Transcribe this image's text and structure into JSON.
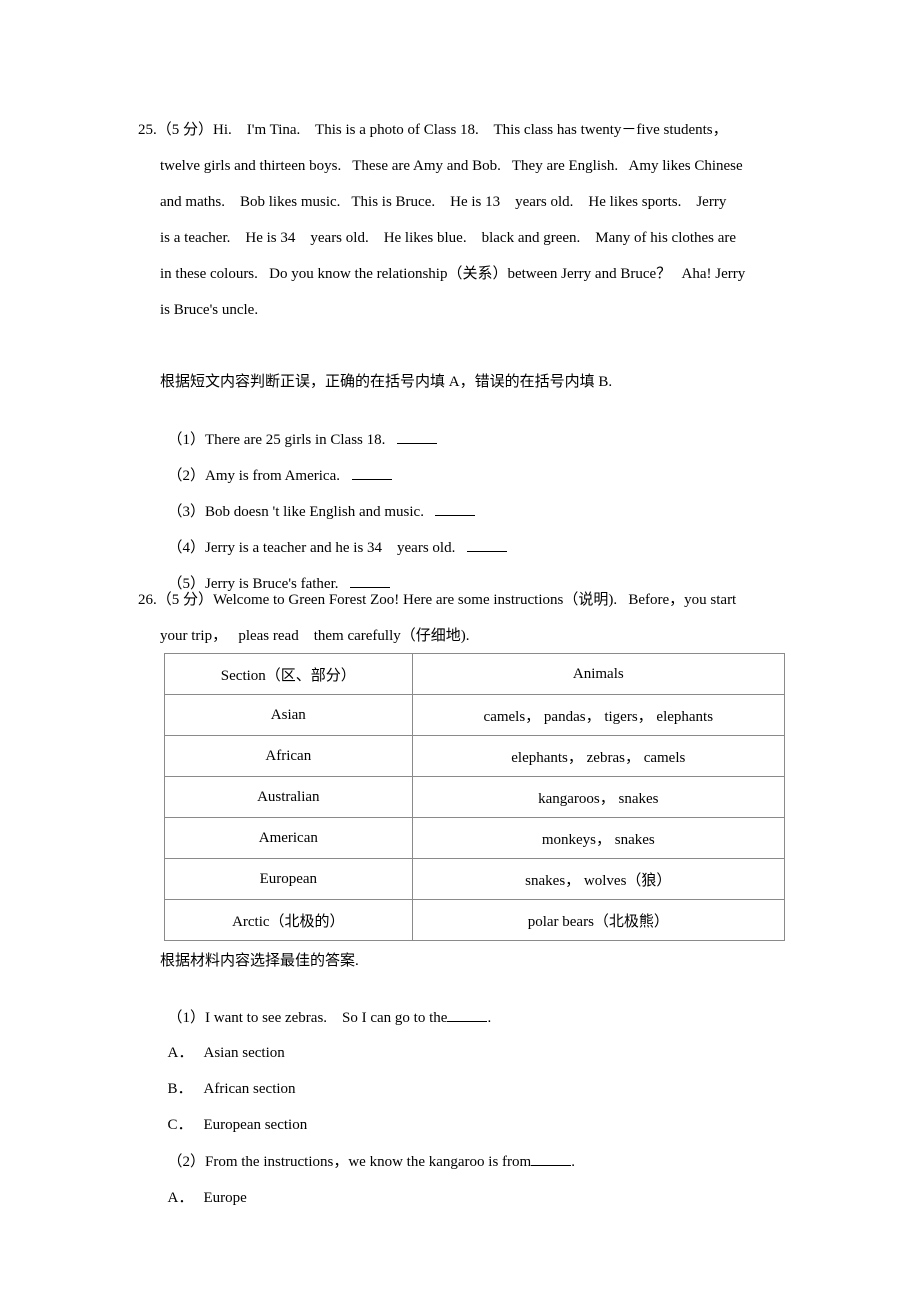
{
  "q25": {
    "lines": [
      "25.（5 分）Hi.    I'm Tina.    This is a photo of Class 18.    This class has twenty－five students，",
      "twelve girls and thirteen boys.   These are Amy and Bob.   They are English.   Amy likes Chinese",
      "and maths.    Bob likes music.   This is Bruce.    He is 13    years old.    He likes sports.    Jerry",
      "is a teacher.    He is 34    years old.    He likes blue.    black and green.    Many of his clothes are",
      "in these colours.   Do you know the relationship（关系）between Jerry and Bruce？   Aha! Jerry",
      "is Bruce's uncle."
    ],
    "instruction": "根据短文内容判断正误，正确的在括号内填 A，错误的在括号内填 B.",
    "questions": [
      {
        "num": "（1）",
        "text": "There are 25 girls in Class 18.  "
      },
      {
        "num": "（2）",
        "text": "Amy is from America.  "
      },
      {
        "num": "（3）",
        "text": "Bob doesn 't like English and music.  "
      },
      {
        "num": "（4）",
        "text": "Jerry is a teacher and he is 34    years old.  "
      },
      {
        "num": "（5）",
        "text": "Jerry is Bruce's father.  "
      }
    ]
  },
  "q26": {
    "lines": [
      "26.（5 分）Welcome to Green Forest Zoo! Here are some instructions（说明).   Before，you start",
      "your trip，   pleas read    them carefully（仔细地)."
    ],
    "table": {
      "headers": [
        "Section（区、部分）",
        "Animals"
      ],
      "rows": [
        [
          "Asian",
          "camels，   pandas，   tigers，   elephants"
        ],
        [
          "African",
          "elephants，   zebras，   camels"
        ],
        [
          "Australian",
          "kangaroos，   snakes"
        ],
        [
          "American",
          "monkeys，   snakes"
        ],
        [
          "European",
          "snakes，   wolves（狼）"
        ],
        [
          "Arctic（北极的）",
          "polar bears（北极熊）"
        ]
      ]
    },
    "instruction": "根据材料内容选择最佳的答案.",
    "q1": {
      "text": "（1）I want to see zebras.    So I can go to the",
      "end": ".",
      "options": [
        {
          "letter": "A．",
          "text": "Asian section"
        },
        {
          "letter": "B．",
          "text": "African section"
        },
        {
          "letter": "C．",
          "text": "European section"
        }
      ]
    },
    "q2": {
      "text": "（2）From the instructions，we know the kangaroo is from",
      "end": ".",
      "options": [
        {
          "letter": "A．",
          "text": "Europe"
        }
      ]
    }
  }
}
